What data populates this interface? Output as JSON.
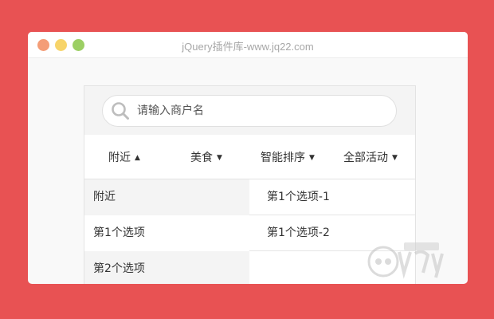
{
  "window": {
    "title": "jQuery插件库-www.jq22.com"
  },
  "search": {
    "placeholder": "请输入商户名",
    "value": ""
  },
  "filters": [
    {
      "label": "附近",
      "arrow": "▲"
    },
    {
      "label": "美食",
      "arrow": "▼"
    },
    {
      "label": "智能排序",
      "arrow": "▼"
    },
    {
      "label": "全部活动",
      "arrow": "▼"
    }
  ],
  "left_list": [
    "附近",
    "第1个选项",
    "第2个选项"
  ],
  "right_list": [
    "第1个选项-1",
    "第1个选项-2"
  ],
  "colors": {
    "background": "#e85253",
    "window": "#f9f9f9",
    "traffic_red": "#f49d77",
    "traffic_yellow": "#f7d46a",
    "traffic_green": "#9ccf64"
  },
  "watermark": {
    "brand": "jQuery",
    "cn_label": "插件库"
  }
}
